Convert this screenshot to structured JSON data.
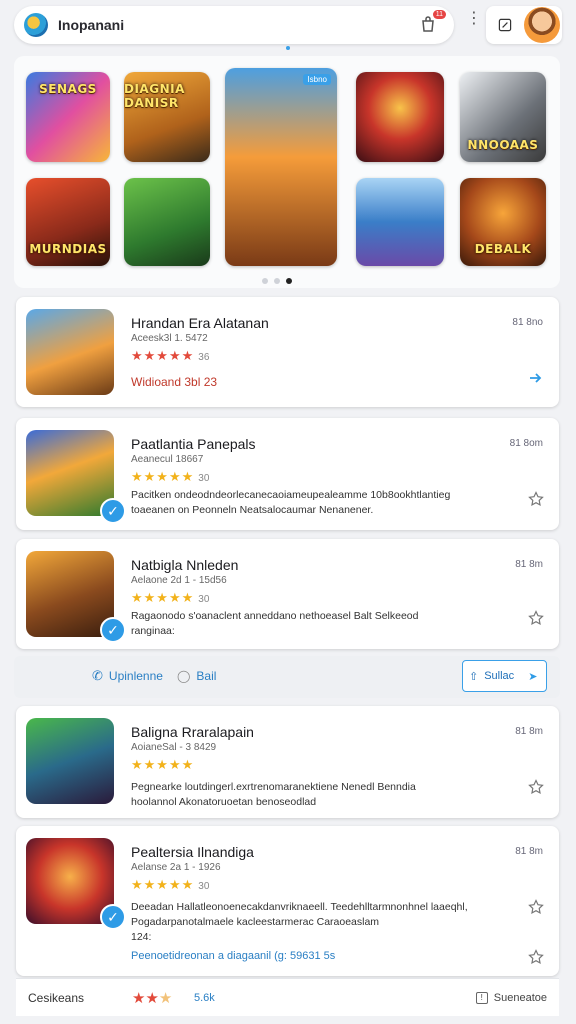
{
  "header": {
    "app_name": "Inopanani",
    "notification_count": "11",
    "accent": "#3aa0e8"
  },
  "featured": {
    "tiles": [
      {
        "title": "SENAGS",
        "icon": "fighter-squad-art"
      },
      {
        "title": "DIAGNIA DANISR",
        "icon": "knight-art"
      },
      {
        "title": "",
        "icon": "adventure-hero-art",
        "badge": "Isbno"
      },
      {
        "title": "",
        "icon": "fire-warrior-art"
      },
      {
        "title": "NNOOAAS",
        "icon": "battle-tank-art"
      },
      {
        "title": "MURNDIAS",
        "icon": "pirate-art"
      },
      {
        "title": "",
        "icon": "army-field-art"
      },
      {
        "title": "",
        "icon": "mountain-landscape-art"
      },
      {
        "title": "DEBALK",
        "icon": "dwarf-warrior-art"
      }
    ],
    "pager": {
      "pages": 3,
      "active": 3
    }
  },
  "cards": [
    {
      "title": "Hrandan Era Alatanan",
      "meta": "Aceesk3l 1. 5472",
      "stars_filled": 5,
      "star_color": "#e24a3b",
      "score": "36",
      "price": "81 8no",
      "extra_red": "Widioand 3bl 23",
      "action": "share-icon"
    },
    {
      "title": "Paatlantia Panepals",
      "meta": "Aeanecul 18667",
      "stars_filled": 5,
      "star_color": "#f2b21b",
      "score": "30",
      "price": "81 8om",
      "desc1": "Pacitken ondeodndeorlecanecaoiameupealeamme 10b8ookhtlantieg",
      "desc2": "toaeanen on Peonneln Neatsalocaumar Nenanener.",
      "action": "star-icon",
      "verified": true
    },
    {
      "title": "Natbigla Nnleden",
      "meta": "Aelaone 2d 1 - 15d56",
      "stars_filled": 5,
      "star_color": "#f2b21b",
      "score": "30",
      "price": "81 8m",
      "desc1": "Ragaonodo s'oanaclent anneddano nethoeasel Balt Selkeeod",
      "desc2": "ranginaa:",
      "action": "star-icon",
      "verified": true
    },
    {
      "title": "Baligna Rraralapain",
      "meta": "AoianeSal - 3 8429",
      "stars_filled": 5,
      "star_color": "#f2b21b",
      "score": "",
      "price": "81 8m",
      "desc1": "Pegnearke loutdingerl.exrtrenomaranektiene Nenedl Benndia",
      "desc2": "hoolannol Akonatoruoetan benoseodlad",
      "action": "star-icon"
    },
    {
      "title": "Pealtersia Ilnandiga",
      "meta": "Aelanse 2a 1 - 1926",
      "stars_filled": 5,
      "star_color": "#f2b21b",
      "score": "30",
      "price": "81 8m",
      "desc1": "Deeadan Hallatleonoenecakdanvriknaeell. Teedehlltarmnonhnel laaeqhl,",
      "desc2": "Pogadarpanotalmaele kacleestarmerac Caraoeaslam",
      "desc3": "124:",
      "extra_link": "Peenoetidreonan a diagaanil (g: 59631 5s",
      "action": "star-icon",
      "verified": true
    }
  ],
  "filterbar": {
    "left_label": "Upinlenne",
    "bail_label": "Bail",
    "right_label": "Sullac"
  },
  "bottom": {
    "label": "Cesikeans",
    "score": "5.6k",
    "right_label": "Sueneatoe"
  }
}
